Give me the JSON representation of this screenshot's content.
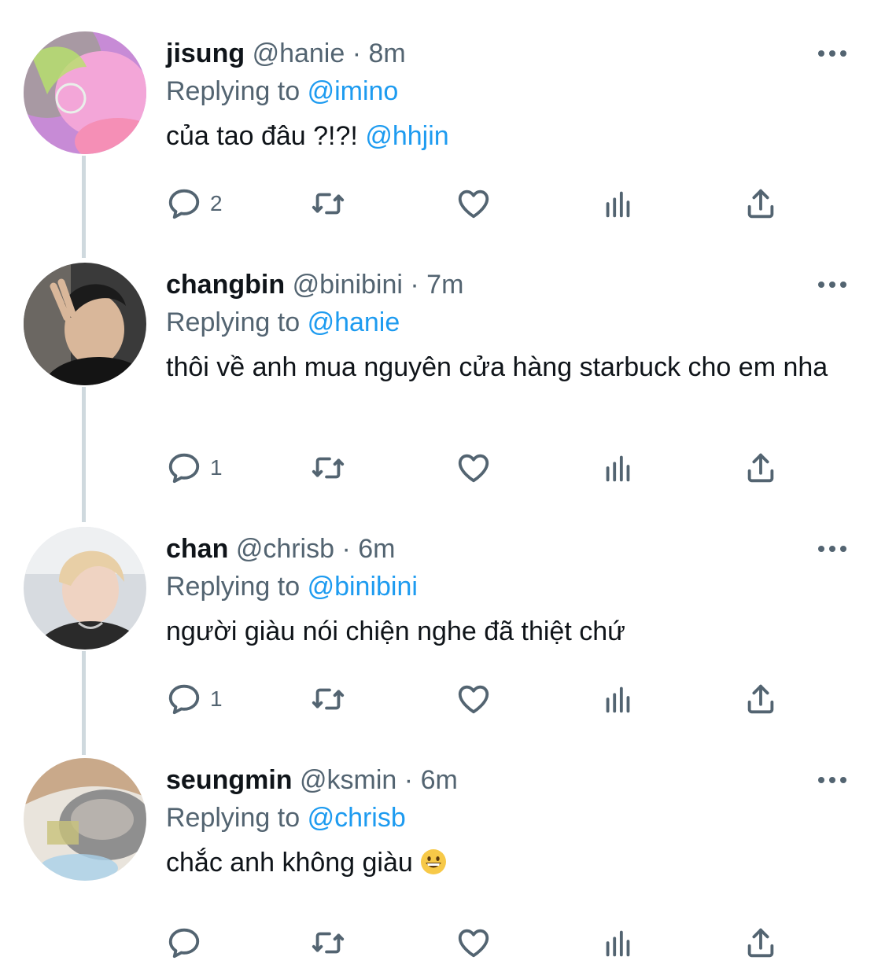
{
  "tweets": [
    {
      "name": "jisung",
      "handle": "@hanie",
      "sep": "·",
      "time": "8m",
      "replying_label": "Replying to",
      "replying_to": "@imino",
      "text": "của tao đâu ?!?!",
      "text_mention": "@hhjin",
      "reply_count": "2"
    },
    {
      "name": "changbin",
      "handle": "@binibini",
      "sep": "·",
      "time": "7m",
      "replying_label": "Replying to",
      "replying_to": "@hanie",
      "text": "thôi về anh mua nguyên cửa hàng starbuck cho em nha",
      "reply_count": "1"
    },
    {
      "name": "chan",
      "handle": "@chrisb",
      "sep": "·",
      "time": "6m",
      "replying_label": "Replying to",
      "replying_to": "@binibini",
      "text": "người giàu nói chiện nghe đã thiệt chứ",
      "reply_count": "1"
    },
    {
      "name": "seungmin",
      "handle": "@ksmin",
      "sep": "·",
      "time": "6m",
      "replying_label": "Replying to",
      "replying_to": "@chrisb",
      "text": "chắc anh không giàu",
      "reply_count": ""
    }
  ],
  "icons": {
    "reply": "reply-icon",
    "retweet": "retweet-icon",
    "like": "heart-icon",
    "analytics": "analytics-icon",
    "share": "share-icon",
    "more": "more-icon",
    "emoji": "grinning-face-emoji"
  },
  "colors": {
    "accent": "#1d9bf0",
    "text": "#0f1419",
    "muted": "#536471",
    "thread_line": "#cfd9de"
  }
}
